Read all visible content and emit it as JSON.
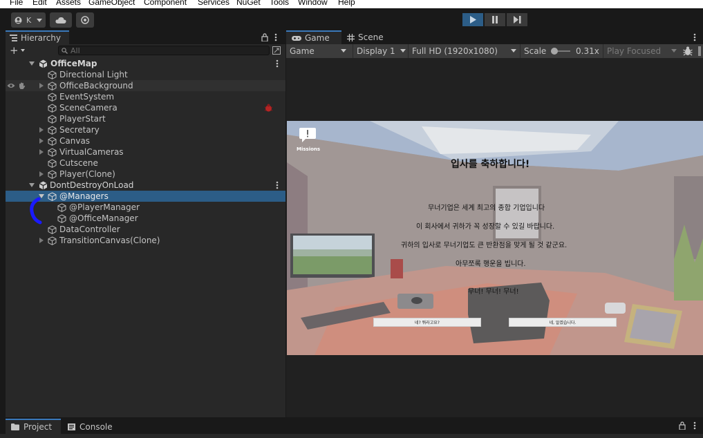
{
  "menu": [
    "File",
    "Edit",
    "Assets",
    "GameObject",
    "Component",
    "Services",
    "NuGet",
    "Tools",
    "Window",
    "Help"
  ],
  "toolbar": {
    "account_label": "K"
  },
  "hierarchy": {
    "tab_label": "Hierarchy",
    "search_placeholder": "All",
    "rows": [
      {
        "label": "OfficeMap",
        "type": "scene"
      },
      {
        "label": "Directional Light"
      },
      {
        "label": "OfficeBackground",
        "expandable": true
      },
      {
        "label": "EventSystem"
      },
      {
        "label": "SceneCamera"
      },
      {
        "label": "PlayerStart"
      },
      {
        "label": "Secretary",
        "expandable": true
      },
      {
        "label": "Canvas",
        "expandable": true
      },
      {
        "label": "VirtualCameras",
        "expandable": true
      },
      {
        "label": "Cutscene"
      },
      {
        "label": "Player(Clone)",
        "expandable": true
      },
      {
        "label": "DontDestroyOnLoad",
        "type": "scene"
      },
      {
        "label": "@Managers",
        "expanded": true,
        "selected": true
      },
      {
        "label": "@PlayerManager"
      },
      {
        "label": "@OfficeManager"
      },
      {
        "label": "DataController"
      },
      {
        "label": "TransitionCanvas(Clone)",
        "expandable": true
      }
    ]
  },
  "game_panel": {
    "tabs": [
      "Game",
      "Scene"
    ],
    "view_mode": "Game",
    "display": "Display 1",
    "resolution": "Full HD (1920x1080)",
    "scale_label": "Scale",
    "scale_value": "0.31x",
    "play_mode": "Play Focused"
  },
  "game_view": {
    "missions_label": "Missions",
    "heading": "입사를 축하합니다!",
    "lines": [
      "무너기업은 세계 최고의 종합 기업입니다",
      "이 회사에서 귀하가 꼭 성장할 수 있길 바랍니다.",
      "귀하의 입사로 무너기업도 큰 반환점을 맞게 될 것 같군요.",
      "아무쪼록 행운을 빕니다."
    ],
    "shout": "무너! 무너! 무너!",
    "button_left": "네? 뭐라고요?",
    "button_right": "네, 알겠습니다."
  },
  "bottom_tabs": [
    "Project",
    "Console"
  ],
  "colors": {
    "selection": "#2c5d87",
    "accent": "#3a79bb",
    "play_active": "#2c5d87",
    "annotation_stroke": "#1a1aff"
  }
}
